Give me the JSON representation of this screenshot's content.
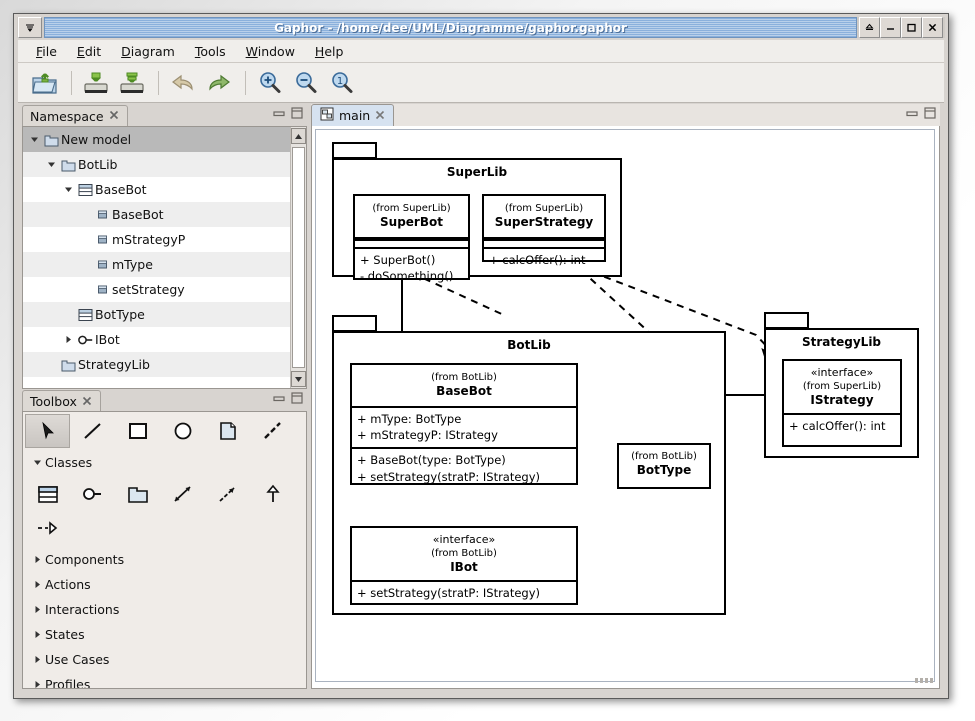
{
  "window": {
    "title": "Gaphor - /home/dee/UML/Diagramme/gaphor.gaphor",
    "menu_button_icon": "window-menu-icon",
    "controls": [
      {
        "name": "shade-button",
        "glyph": "△"
      },
      {
        "name": "minimize-button",
        "glyph": "—"
      },
      {
        "name": "maximize-button",
        "glyph": "☐"
      },
      {
        "name": "close-button",
        "glyph": "✕"
      }
    ]
  },
  "menubar": {
    "items": [
      {
        "mnemonic": "F",
        "rest": "ile"
      },
      {
        "mnemonic": "E",
        "rest": "dit"
      },
      {
        "mnemonic": "D",
        "rest": "iagram"
      },
      {
        "mnemonic": "T",
        "rest": "ools"
      },
      {
        "mnemonic": "W",
        "rest": "indow"
      },
      {
        "mnemonic": "H",
        "rest": "elp"
      }
    ]
  },
  "toolbar": {
    "buttons": [
      {
        "name": "open-icon",
        "title": "Open"
      },
      {
        "name": "save-icon",
        "title": "Save"
      },
      {
        "name": "save-as-icon",
        "title": "Save As"
      },
      {
        "name": "undo-icon",
        "title": "Undo"
      },
      {
        "name": "redo-icon",
        "title": "Redo"
      },
      {
        "name": "zoom-in-icon",
        "title": "Zoom In"
      },
      {
        "name": "zoom-out-icon",
        "title": "Zoom Out"
      },
      {
        "name": "zoom-100-icon",
        "title": "Zoom 100%",
        "label": "1"
      }
    ]
  },
  "namespace_panel": {
    "title": "Namespace",
    "close_glyph": "✕",
    "minimize_glyph": "minimize-icon",
    "maximize_glyph": "maximize-icon",
    "tree": [
      {
        "label": "New model",
        "depth": 0,
        "icon": "package-icon",
        "expander": "down",
        "selected": true
      },
      {
        "label": "BotLib",
        "depth": 1,
        "icon": "package-icon",
        "expander": "down",
        "selected": false
      },
      {
        "label": "BaseBot",
        "depth": 2,
        "icon": "class-icon",
        "expander": "down",
        "selected": false
      },
      {
        "label": "BaseBot",
        "depth": 3,
        "icon": "attribute-icon",
        "expander": "none",
        "selected": false
      },
      {
        "label": "mStrategyP",
        "depth": 3,
        "icon": "attribute-icon",
        "expander": "none",
        "selected": false
      },
      {
        "label": "mType",
        "depth": 3,
        "icon": "attribute-icon",
        "expander": "none",
        "selected": false
      },
      {
        "label": "setStrategy",
        "depth": 3,
        "icon": "attribute-icon",
        "expander": "none",
        "selected": false
      },
      {
        "label": "BotType",
        "depth": 2,
        "icon": "class-icon",
        "expander": "none",
        "selected": false
      },
      {
        "label": "IBot",
        "depth": 2,
        "icon": "interface-icon",
        "expander": "right",
        "selected": false
      },
      {
        "label": "StrategyLib",
        "depth": 1,
        "icon": "package-icon",
        "expander": "none",
        "selected": false
      }
    ],
    "scroll_up": "▲",
    "scroll_down": "▼"
  },
  "toolbox_panel": {
    "title": "Toolbox",
    "close_glyph": "✕",
    "top_tools": [
      {
        "name": "pointer-tool-icon",
        "active": true
      },
      {
        "name": "line-tool-icon",
        "active": false
      },
      {
        "name": "box-tool-icon",
        "active": false
      },
      {
        "name": "ellipse-tool-icon",
        "active": false
      },
      {
        "name": "comment-tool-icon",
        "active": false
      },
      {
        "name": "comment-line-tool-icon",
        "active": false
      }
    ],
    "sections": [
      {
        "label": "Classes",
        "expanded": true
      },
      {
        "label": "Components",
        "expanded": false
      },
      {
        "label": "Actions",
        "expanded": false
      },
      {
        "label": "Interactions",
        "expanded": false
      },
      {
        "label": "States",
        "expanded": false
      },
      {
        "label": "Use Cases",
        "expanded": false
      },
      {
        "label": "Profiles",
        "expanded": false
      }
    ],
    "class_tools": [
      {
        "name": "class-tool-icon"
      },
      {
        "name": "interface-tool-icon"
      },
      {
        "name": "package-tool-icon"
      },
      {
        "name": "association-tool-icon"
      },
      {
        "name": "dependency-tool-icon"
      },
      {
        "name": "generalization-tool-icon"
      },
      {
        "name": "implementation-tool-icon"
      }
    ]
  },
  "diagram": {
    "tab_label": "main",
    "tab_icon": "diagram-icon",
    "tab_close_glyph": "✕",
    "packages": [
      {
        "name": "SuperLib"
      },
      {
        "name": "BotLib"
      },
      {
        "name": "StrategyLib"
      }
    ],
    "classes": [
      {
        "id": "superbot",
        "from": "(from SuperLib)",
        "name": "SuperBot",
        "stereotype": "",
        "attributes": [],
        "operations": [
          "+ SuperBot()",
          "- doSomething()"
        ]
      },
      {
        "id": "superstrategy",
        "from": "(from SuperLib)",
        "name": "SuperStrategy",
        "stereotype": "",
        "attributes": [],
        "operations": [
          "+ calcOffer(): int"
        ]
      },
      {
        "id": "basebot",
        "from": "(from BotLib)",
        "name": "BaseBot",
        "stereotype": "",
        "attributes": [
          "+ mType: BotType",
          "+ mStrategyP: IStrategy"
        ],
        "operations": [
          "+ BaseBot(type: BotType)",
          "+ setStrategy(stratP: IStrategy)"
        ]
      },
      {
        "id": "bottype",
        "from": "(from BotLib)",
        "name": "BotType",
        "stereotype": "",
        "attributes": [],
        "operations": []
      },
      {
        "id": "ibot",
        "from": "(from BotLib)",
        "name": "IBot",
        "stereotype": "«interface»",
        "attributes": [],
        "operations": [
          "+ setStrategy(stratP: IStrategy)"
        ]
      },
      {
        "id": "istrategy",
        "from": "(from SuperLib)",
        "name": "IStrategy",
        "stereotype": "«interface»",
        "attributes": [],
        "operations": [
          "+ calcOffer(): int"
        ]
      }
    ],
    "relationships": [
      {
        "type": "generalization",
        "from": "SuperBot",
        "to": "BaseBot"
      },
      {
        "type": "realization",
        "from": "BaseBot",
        "to": "IBot"
      },
      {
        "type": "aggregation",
        "from": "BaseBot",
        "to": "IStrategy"
      },
      {
        "type": "composition",
        "from": "BaseBot",
        "to": "BotType"
      },
      {
        "type": "dependency",
        "from": "SuperLib",
        "to": "BotType"
      },
      {
        "type": "dependency",
        "from": "SuperLib",
        "to": "StrategyLib"
      }
    ]
  },
  "colors": {
    "title_bar": "#8ab0dc",
    "panel_bg": "#f0ece8",
    "tree_selected": "#b9b9b9",
    "tab_active": "#d6e2f0",
    "diagram_line": "#000000"
  }
}
